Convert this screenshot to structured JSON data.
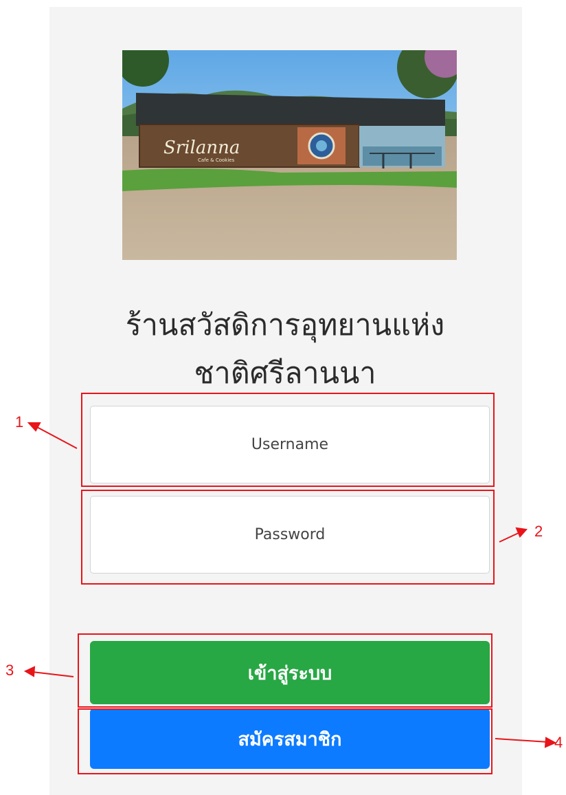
{
  "store": {
    "title_line1": "ร้านสวัสดิการอุทยานแห่ง",
    "title_line2": "ชาติศรีลานนา",
    "photo_sign_text": "Srilanna",
    "photo_sign_subtext": "Cafe & Cookies"
  },
  "form": {
    "username_placeholder": "Username",
    "password_placeholder": "Password",
    "login_label": "เข้าสู่ระบบ",
    "register_label": "สมัครสมาชิก"
  },
  "annotations": {
    "labels": [
      "1",
      "2",
      "3",
      "4"
    ],
    "color": "#e8141a"
  },
  "colors": {
    "login_button": "#28a745",
    "register_button": "#0d7bff",
    "card_background": "#f4f4f4"
  }
}
